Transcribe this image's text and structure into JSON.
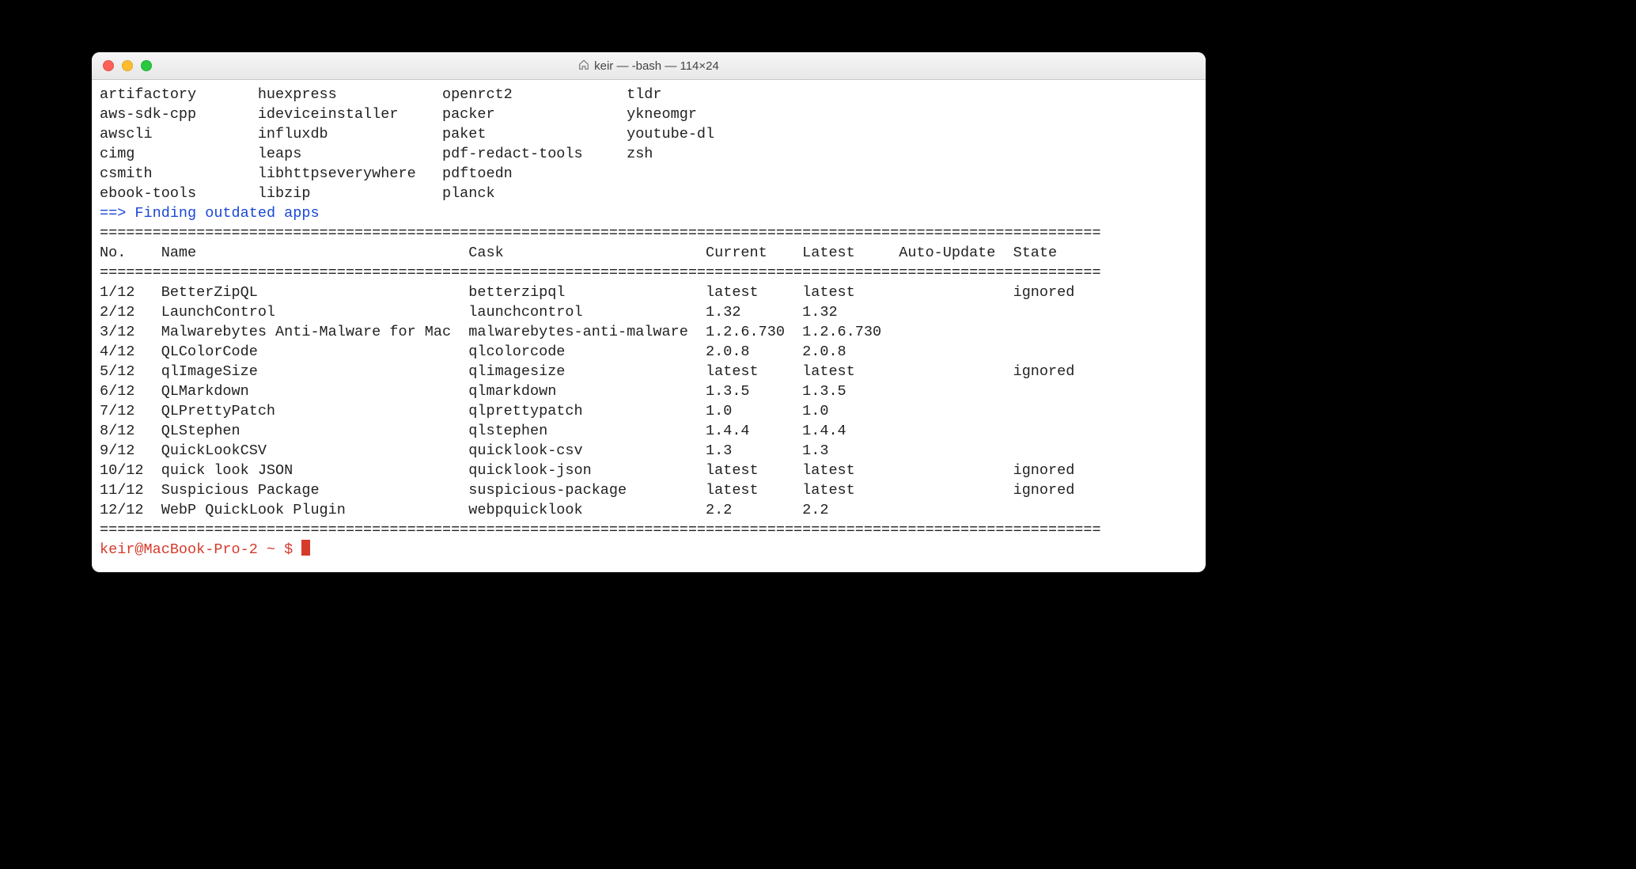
{
  "window": {
    "title": "keir — -bash — 114×24"
  },
  "packages_columns": [
    [
      "artifactory",
      "aws-sdk-cpp",
      "awscli",
      "cimg",
      "csmith",
      "ebook-tools"
    ],
    [
      "huexpress",
      "ideviceinstaller",
      "influxdb",
      "leaps",
      "libhttpseverywhere",
      "libzip"
    ],
    [
      "openrct2",
      "packer",
      "paket",
      "pdf-redact-tools",
      "pdftoedn",
      "planck"
    ],
    [
      "tldr",
      "ykneomgr",
      "youtube-dl",
      "zsh",
      "",
      ""
    ]
  ],
  "status": {
    "arrow": "==>",
    "text": " Finding outdated apps"
  },
  "table": {
    "rule": "==================================================================================================================",
    "columns": [
      "No.",
      "Name",
      "Cask",
      "Current",
      "Latest",
      "Auto-Update",
      "State"
    ],
    "rows": [
      {
        "no": "1/12",
        "name": "BetterZipQL",
        "cask": "betterzipql",
        "current": "latest",
        "latest": "latest",
        "auto": "",
        "state": "ignored"
      },
      {
        "no": "2/12",
        "name": "LaunchControl",
        "cask": "launchcontrol",
        "current": "1.32",
        "latest": "1.32",
        "auto": "",
        "state": ""
      },
      {
        "no": "3/12",
        "name": "Malwarebytes Anti-Malware for Mac",
        "cask": "malwarebytes-anti-malware",
        "current": "1.2.6.730",
        "latest": "1.2.6.730",
        "auto": "",
        "state": ""
      },
      {
        "no": "4/12",
        "name": "QLColorCode",
        "cask": "qlcolorcode",
        "current": "2.0.8",
        "latest": "2.0.8",
        "auto": "",
        "state": ""
      },
      {
        "no": "5/12",
        "name": "qlImageSize",
        "cask": "qlimagesize",
        "current": "latest",
        "latest": "latest",
        "auto": "",
        "state": "ignored"
      },
      {
        "no": "6/12",
        "name": "QLMarkdown",
        "cask": "qlmarkdown",
        "current": "1.3.5",
        "latest": "1.3.5",
        "auto": "",
        "state": ""
      },
      {
        "no": "7/12",
        "name": "QLPrettyPatch",
        "cask": "qlprettypatch",
        "current": "1.0",
        "latest": "1.0",
        "auto": "",
        "state": ""
      },
      {
        "no": "8/12",
        "name": "QLStephen",
        "cask": "qlstephen",
        "current": "1.4.4",
        "latest": "1.4.4",
        "auto": "",
        "state": ""
      },
      {
        "no": "9/12",
        "name": "QuickLookCSV",
        "cask": "quicklook-csv",
        "current": "1.3",
        "latest": "1.3",
        "auto": "",
        "state": ""
      },
      {
        "no": "10/12",
        "name": "quick look JSON",
        "cask": "quicklook-json",
        "current": "latest",
        "latest": "latest",
        "auto": "",
        "state": "ignored"
      },
      {
        "no": "11/12",
        "name": "Suspicious Package",
        "cask": "suspicious-package",
        "current": "latest",
        "latest": "latest",
        "auto": "",
        "state": "ignored"
      },
      {
        "no": "12/12",
        "name": "WebP QuickLook Plugin",
        "cask": "webpquicklook",
        "current": "2.2",
        "latest": "2.2",
        "auto": "",
        "state": ""
      }
    ]
  },
  "prompt": "keir@MacBook-Pro-2 ~ $ "
}
